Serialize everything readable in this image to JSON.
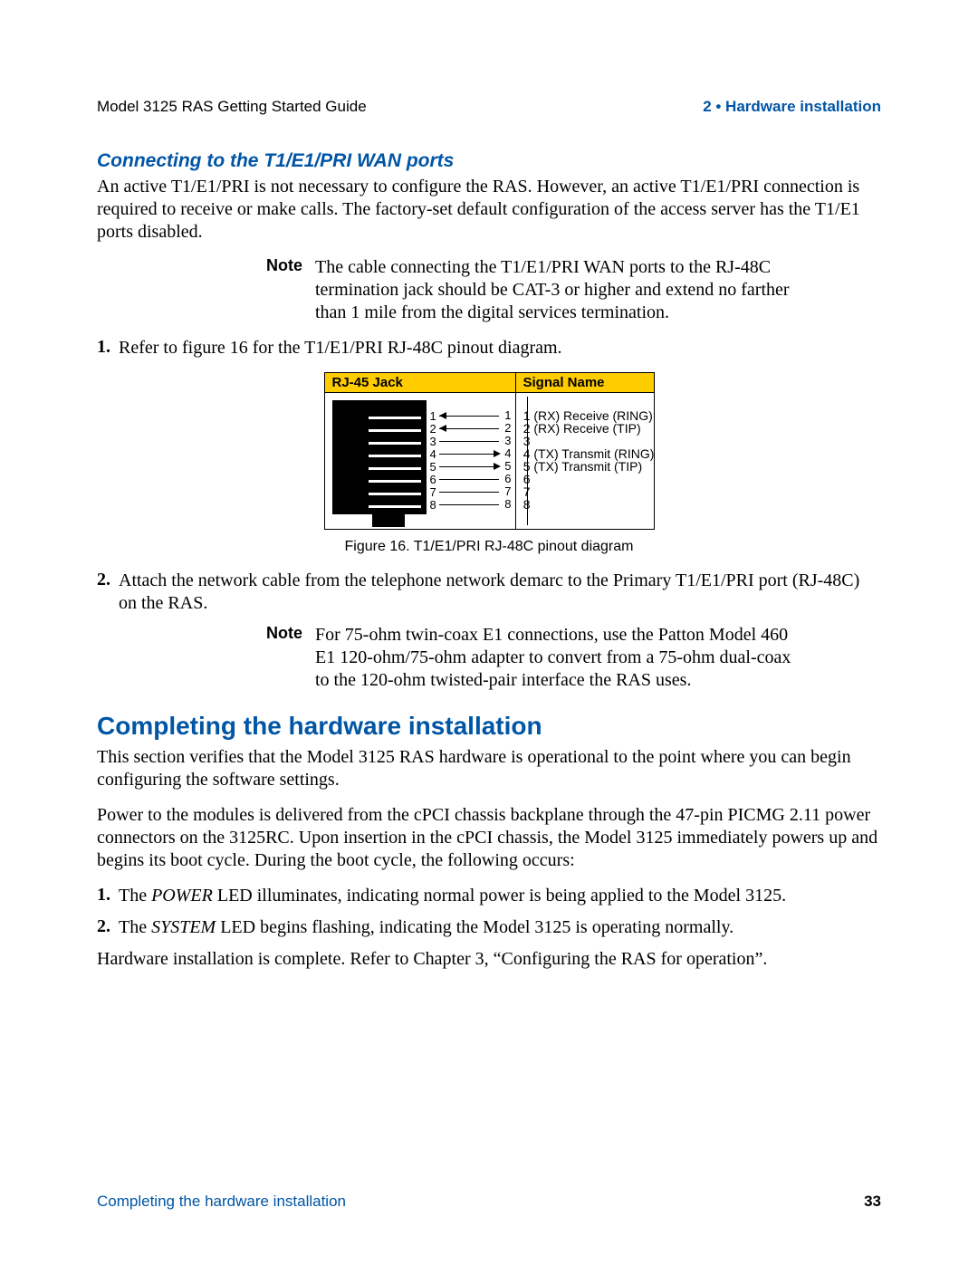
{
  "header": {
    "left": "Model 3125 RAS Getting Started Guide",
    "right": "2 • Hardware installation"
  },
  "section1": {
    "heading": "Connecting to the T1/E1/PRI WAN ports",
    "intro": "An active T1/E1/PRI is not necessary to configure the RAS. However, an active T1/E1/PRI connection is required to receive or make calls. The factory-set default configuration of the access server has the T1/E1 ports disabled.",
    "note1_label": "Note",
    "note1_body": "The cable connecting the T1/E1/PRI WAN ports to the RJ-48C termination jack should be CAT-3 or higher and extend no farther than 1 mile from the digital services termination.",
    "step1_num": "1.",
    "step1": "Refer to figure 16 for the T1/E1/PRI RJ-48C pinout diagram.",
    "table": {
      "col1": "RJ-45 Jack",
      "col2": "Signal Name",
      "jack_pins": [
        "1",
        "2",
        "3",
        "4",
        "5",
        "6",
        "7",
        "8"
      ],
      "signals": [
        {
          "n": "1",
          "label": "(RX) Receive (RING)"
        },
        {
          "n": "2",
          "label": "(RX) Receive (TIP)"
        },
        {
          "n": "3",
          "label": ""
        },
        {
          "n": "4",
          "label": "(TX) Transmit (RING)"
        },
        {
          "n": "5",
          "label": "(TX) Transmit (TIP)"
        },
        {
          "n": "6",
          "label": ""
        },
        {
          "n": "7",
          "label": ""
        },
        {
          "n": "8",
          "label": ""
        }
      ]
    },
    "caption": "Figure 16. T1/E1/PRI RJ-48C pinout diagram",
    "step2_num": "2.",
    "step2": "Attach the network cable from the telephone network demarc to the Primary T1/E1/PRI port (RJ-48C) on the RAS.",
    "note2_label": "Note",
    "note2_body": "For 75-ohm twin-coax  E1 connections,  use the Patton Model 460 E1 120-ohm/75-ohm adapter to convert from a 75-ohm dual-coax to the 120-ohm twisted-pair interface the RAS uses."
  },
  "section2": {
    "heading": "Completing the hardware installation",
    "p1": "This section verifies that the Model 3125 RAS hardware is operational to the point where you can begin configuring the software settings.",
    "p2": "Power to the modules is delivered from the cPCI chassis backplane through the 47-pin PICMG 2.11 power connectors on the 3125RC. Upon insertion in the cPCI chassis, the Model 3125 immediately powers up and begins its boot cycle. During the boot cycle, the following occurs:",
    "s1_num": "1.",
    "s1_pre": "The ",
    "s1_em": "POWER",
    "s1_post": " LED illuminates, indicating normal power is being applied to the Model 3125.",
    "s2_num": "2.",
    "s2_pre": "The ",
    "s2_em": "SYSTEM",
    "s2_post": " LED begins flashing, indicating the Model 3125 is operating normally.",
    "p3": "Hardware installation is complete. Refer to Chapter 3, “Configuring the RAS for operation”."
  },
  "footer": {
    "left": "Completing the hardware installation",
    "right": "33"
  }
}
